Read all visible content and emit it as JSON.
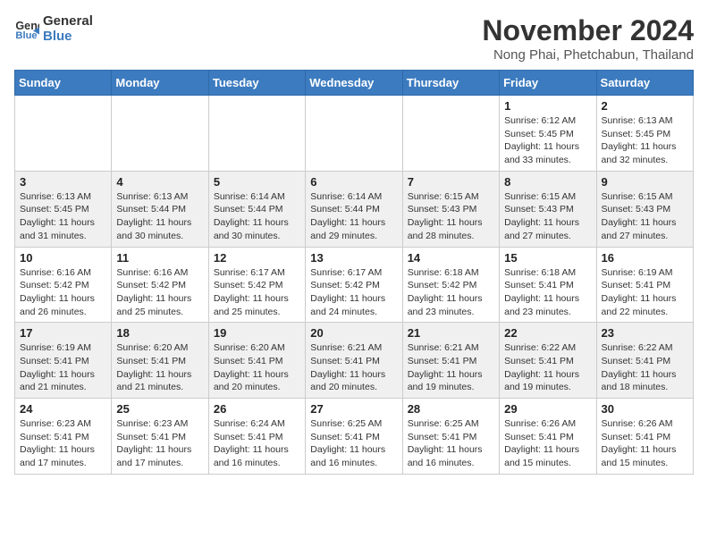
{
  "logo": {
    "line1": "General",
    "line2": "Blue"
  },
  "title": "November 2024",
  "location": "Nong Phai, Phetchabun, Thailand",
  "days_of_week": [
    "Sunday",
    "Monday",
    "Tuesday",
    "Wednesday",
    "Thursday",
    "Friday",
    "Saturday"
  ],
  "weeks": [
    [
      {
        "day": "",
        "info": ""
      },
      {
        "day": "",
        "info": ""
      },
      {
        "day": "",
        "info": ""
      },
      {
        "day": "",
        "info": ""
      },
      {
        "day": "",
        "info": ""
      },
      {
        "day": "1",
        "info": "Sunrise: 6:12 AM\nSunset: 5:45 PM\nDaylight: 11 hours and 33 minutes."
      },
      {
        "day": "2",
        "info": "Sunrise: 6:13 AM\nSunset: 5:45 PM\nDaylight: 11 hours and 32 minutes."
      }
    ],
    [
      {
        "day": "3",
        "info": "Sunrise: 6:13 AM\nSunset: 5:45 PM\nDaylight: 11 hours and 31 minutes."
      },
      {
        "day": "4",
        "info": "Sunrise: 6:13 AM\nSunset: 5:44 PM\nDaylight: 11 hours and 30 minutes."
      },
      {
        "day": "5",
        "info": "Sunrise: 6:14 AM\nSunset: 5:44 PM\nDaylight: 11 hours and 30 minutes."
      },
      {
        "day": "6",
        "info": "Sunrise: 6:14 AM\nSunset: 5:44 PM\nDaylight: 11 hours and 29 minutes."
      },
      {
        "day": "7",
        "info": "Sunrise: 6:15 AM\nSunset: 5:43 PM\nDaylight: 11 hours and 28 minutes."
      },
      {
        "day": "8",
        "info": "Sunrise: 6:15 AM\nSunset: 5:43 PM\nDaylight: 11 hours and 27 minutes."
      },
      {
        "day": "9",
        "info": "Sunrise: 6:15 AM\nSunset: 5:43 PM\nDaylight: 11 hours and 27 minutes."
      }
    ],
    [
      {
        "day": "10",
        "info": "Sunrise: 6:16 AM\nSunset: 5:42 PM\nDaylight: 11 hours and 26 minutes."
      },
      {
        "day": "11",
        "info": "Sunrise: 6:16 AM\nSunset: 5:42 PM\nDaylight: 11 hours and 25 minutes."
      },
      {
        "day": "12",
        "info": "Sunrise: 6:17 AM\nSunset: 5:42 PM\nDaylight: 11 hours and 25 minutes."
      },
      {
        "day": "13",
        "info": "Sunrise: 6:17 AM\nSunset: 5:42 PM\nDaylight: 11 hours and 24 minutes."
      },
      {
        "day": "14",
        "info": "Sunrise: 6:18 AM\nSunset: 5:42 PM\nDaylight: 11 hours and 23 minutes."
      },
      {
        "day": "15",
        "info": "Sunrise: 6:18 AM\nSunset: 5:41 PM\nDaylight: 11 hours and 23 minutes."
      },
      {
        "day": "16",
        "info": "Sunrise: 6:19 AM\nSunset: 5:41 PM\nDaylight: 11 hours and 22 minutes."
      }
    ],
    [
      {
        "day": "17",
        "info": "Sunrise: 6:19 AM\nSunset: 5:41 PM\nDaylight: 11 hours and 21 minutes."
      },
      {
        "day": "18",
        "info": "Sunrise: 6:20 AM\nSunset: 5:41 PM\nDaylight: 11 hours and 21 minutes."
      },
      {
        "day": "19",
        "info": "Sunrise: 6:20 AM\nSunset: 5:41 PM\nDaylight: 11 hours and 20 minutes."
      },
      {
        "day": "20",
        "info": "Sunrise: 6:21 AM\nSunset: 5:41 PM\nDaylight: 11 hours and 20 minutes."
      },
      {
        "day": "21",
        "info": "Sunrise: 6:21 AM\nSunset: 5:41 PM\nDaylight: 11 hours and 19 minutes."
      },
      {
        "day": "22",
        "info": "Sunrise: 6:22 AM\nSunset: 5:41 PM\nDaylight: 11 hours and 19 minutes."
      },
      {
        "day": "23",
        "info": "Sunrise: 6:22 AM\nSunset: 5:41 PM\nDaylight: 11 hours and 18 minutes."
      }
    ],
    [
      {
        "day": "24",
        "info": "Sunrise: 6:23 AM\nSunset: 5:41 PM\nDaylight: 11 hours and 17 minutes."
      },
      {
        "day": "25",
        "info": "Sunrise: 6:23 AM\nSunset: 5:41 PM\nDaylight: 11 hours and 17 minutes."
      },
      {
        "day": "26",
        "info": "Sunrise: 6:24 AM\nSunset: 5:41 PM\nDaylight: 11 hours and 16 minutes."
      },
      {
        "day": "27",
        "info": "Sunrise: 6:25 AM\nSunset: 5:41 PM\nDaylight: 11 hours and 16 minutes."
      },
      {
        "day": "28",
        "info": "Sunrise: 6:25 AM\nSunset: 5:41 PM\nDaylight: 11 hours and 16 minutes."
      },
      {
        "day": "29",
        "info": "Sunrise: 6:26 AM\nSunset: 5:41 PM\nDaylight: 11 hours and 15 minutes."
      },
      {
        "day": "30",
        "info": "Sunrise: 6:26 AM\nSunset: 5:41 PM\nDaylight: 11 hours and 15 minutes."
      }
    ]
  ]
}
